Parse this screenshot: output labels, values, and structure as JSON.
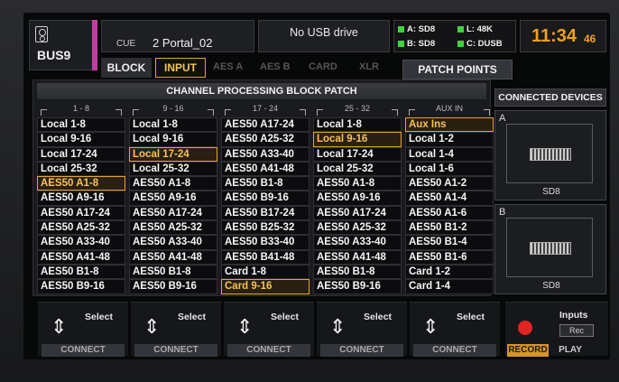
{
  "header": {
    "bus_name": "BUS9",
    "bus_color": "#c23fa0",
    "cue_label": "CUE",
    "cue_value": "2 Portal_02",
    "usb_status": "No USB drive",
    "devices": [
      {
        "label": "A: SD8"
      },
      {
        "label": "L: 48K"
      },
      {
        "label": "B: SD8"
      },
      {
        "label": "C: DUSB"
      }
    ],
    "clock_main": "11:34",
    "clock_sec": "46"
  },
  "tabs": {
    "block": "BLOCK",
    "input": "INPUT",
    "aes_a": "AES A",
    "aes_b": "AES B",
    "card": "CARD",
    "xlr": "XLR",
    "patch_points": "PATCH POINTS"
  },
  "panel": {
    "title": "CHANNEL PROCESSING BLOCK PATCH",
    "columns": [
      {
        "header": "1 - 8",
        "selected": 4,
        "items": [
          "Local 1-8",
          "Local 9-16",
          "Local 17-24",
          "Local 25-32",
          "AES50 A1-8",
          "AES50 A9-16",
          "AES50 A17-24",
          "AES50 A25-32",
          "AES50 A33-40",
          "AES50 A41-48",
          "AES50 B1-8",
          "AES50 B9-16"
        ]
      },
      {
        "header": "9 - 16",
        "selected": 2,
        "items": [
          "Local 1-8",
          "Local 9-16",
          "Local 17-24",
          "Local 25-32",
          "AES50 A1-8",
          "AES50 A9-16",
          "AES50 A17-24",
          "AES50 A25-32",
          "AES50 A33-40",
          "AES50 A41-48",
          "AES50 B1-8",
          "AES50 B9-16"
        ]
      },
      {
        "header": "17 - 24",
        "selected": 11,
        "items": [
          "AES50 A17-24",
          "AES50 A25-32",
          "AES50 A33-40",
          "AES50 A41-48",
          "AES50 B1-8",
          "AES50 B9-16",
          "AES50 B17-24",
          "AES50 B25-32",
          "AES50 B33-40",
          "AES50 B41-48",
          "Card 1-8",
          "Card 9-16"
        ]
      },
      {
        "header": "25 - 32",
        "selected": 1,
        "items": [
          "Local 1-8",
          "Local 9-16",
          "Local 17-24",
          "Local 25-32",
          "AES50 A1-8",
          "AES50 A9-16",
          "AES50 A17-24",
          "AES50 A25-32",
          "AES50 A33-40",
          "AES50 A41-48",
          "AES50 B1-8",
          "AES50 B9-16"
        ]
      },
      {
        "header": "AUX IN",
        "selected": 0,
        "items": [
          "Aux Ins",
          "Local 1-2",
          "Local 1-4",
          "Local 1-6",
          "AES50 A1-2",
          "AES50 A1-4",
          "AES50 A1-6",
          "AES50 B1-2",
          "AES50 B1-4",
          "AES50 B1-6",
          "Card 1-2",
          "Card 1-4"
        ]
      }
    ]
  },
  "connected_devices": {
    "title": "CONNECTED DEVICES",
    "slots": [
      {
        "letter": "A",
        "name": "SD8"
      },
      {
        "letter": "B",
        "name": "SD8"
      }
    ]
  },
  "encoders": [
    {
      "label": "Select",
      "button": "CONNECT"
    },
    {
      "label": "Select",
      "button": "CONNECT"
    },
    {
      "label": "Select",
      "button": "CONNECT"
    },
    {
      "label": "Select",
      "button": "CONNECT"
    },
    {
      "label": "Select",
      "button": "CONNECT"
    }
  ],
  "recorder": {
    "label": "Inputs",
    "sub": "Rec",
    "record": "RECORD",
    "play": "PLAY"
  }
}
